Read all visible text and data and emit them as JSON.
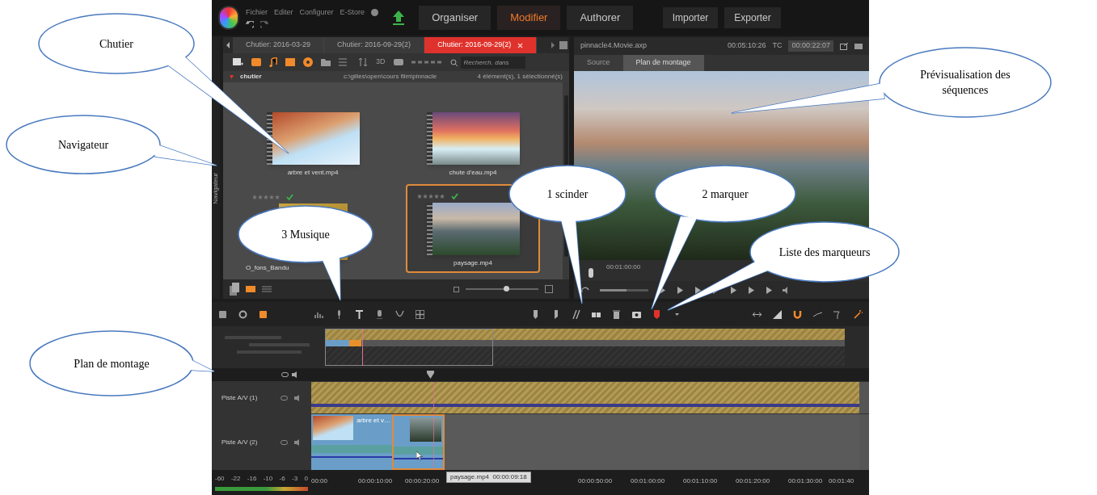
{
  "menu": [
    "Fichier",
    "Editer",
    "Configurer",
    "E-Store"
  ],
  "mode_tabs": [
    {
      "label": "Organiser",
      "selected": false
    },
    {
      "label": "Modifier",
      "selected": true
    },
    {
      "label": "Authorer",
      "selected": false
    }
  ],
  "actions": [
    "Importer",
    "Exporter"
  ],
  "navigator_tab": "Navigateur",
  "library": {
    "tabs": [
      {
        "label": "Chutier: 2016-03-29",
        "selected": false
      },
      {
        "label": "Chutier: 2016-09-29(2)",
        "selected": false
      },
      {
        "label": "Chutier: 2016-09-29(2)",
        "selected": true
      }
    ],
    "toolbar_text": "3D",
    "search": {
      "placeholder": "Recherch. dans"
    },
    "folder": "chutier",
    "path": "c:\\gilles\\open\\cours film\\pinnacle",
    "count": "4 élément(s), 1 sélectionné(s)",
    "items": [
      {
        "name": "arbre et vent.mp4",
        "kind": "video",
        "selected": false
      },
      {
        "name": "chute d'eau.mp4",
        "kind": "video",
        "selected": false
      },
      {
        "name": "O_fons_Bandu",
        "kind": "audio",
        "selected": false,
        "stars": 0,
        "checked": true
      },
      {
        "name": "paysage.mp4",
        "kind": "video",
        "selected": true,
        "stars": 0,
        "checked": true
      }
    ],
    "zoom": {
      "level": 0.55
    }
  },
  "preview": {
    "project": "pinnacle4.Movie.axp",
    "duration": "00:05:10:26",
    "tc_label": "TC",
    "timecode": "00:00:22:07",
    "tabs": [
      {
        "label": "Source",
        "selected": false
      },
      {
        "label": "Plan de montage",
        "selected": true
      }
    ],
    "ruler": [
      "00:01:00:00"
    ],
    "position": {
      "level": 0.05
    },
    "volume": {
      "level": 0.55
    }
  },
  "timeline": {
    "tracks": [
      {
        "name": "Piste A/V (1)",
        "kind": "audio"
      },
      {
        "name": "Piste A/V (2)",
        "kind": "video",
        "clips": [
          {
            "label": "arbre et v…",
            "selected": false
          },
          {
            "selected": true
          }
        ]
      }
    ],
    "meter_scale": [
      "-60",
      "-22",
      "-16",
      "-10",
      "-6",
      "-3",
      "0"
    ],
    "ruler": [
      "00:00",
      "00:00:10:00",
      "00:00:20:00",
      "00:00:50:00",
      "00:01:00:00",
      "00:01:10:00",
      "00:01:20:00",
      "00:01:30:00",
      "00:01:40"
    ],
    "tooltip": "paysage.mp4  00:00:09:18"
  },
  "callouts": [
    {
      "text": "Chutier"
    },
    {
      "text": "Navigateur"
    },
    {
      "text": "Plan de montage"
    },
    {
      "text": "3 Musique"
    },
    {
      "text": "1 scinder"
    },
    {
      "text": "2 marquer"
    },
    {
      "text": "Liste des marqueurs"
    },
    {
      "text": "Prévisualisation des séquences"
    }
  ]
}
